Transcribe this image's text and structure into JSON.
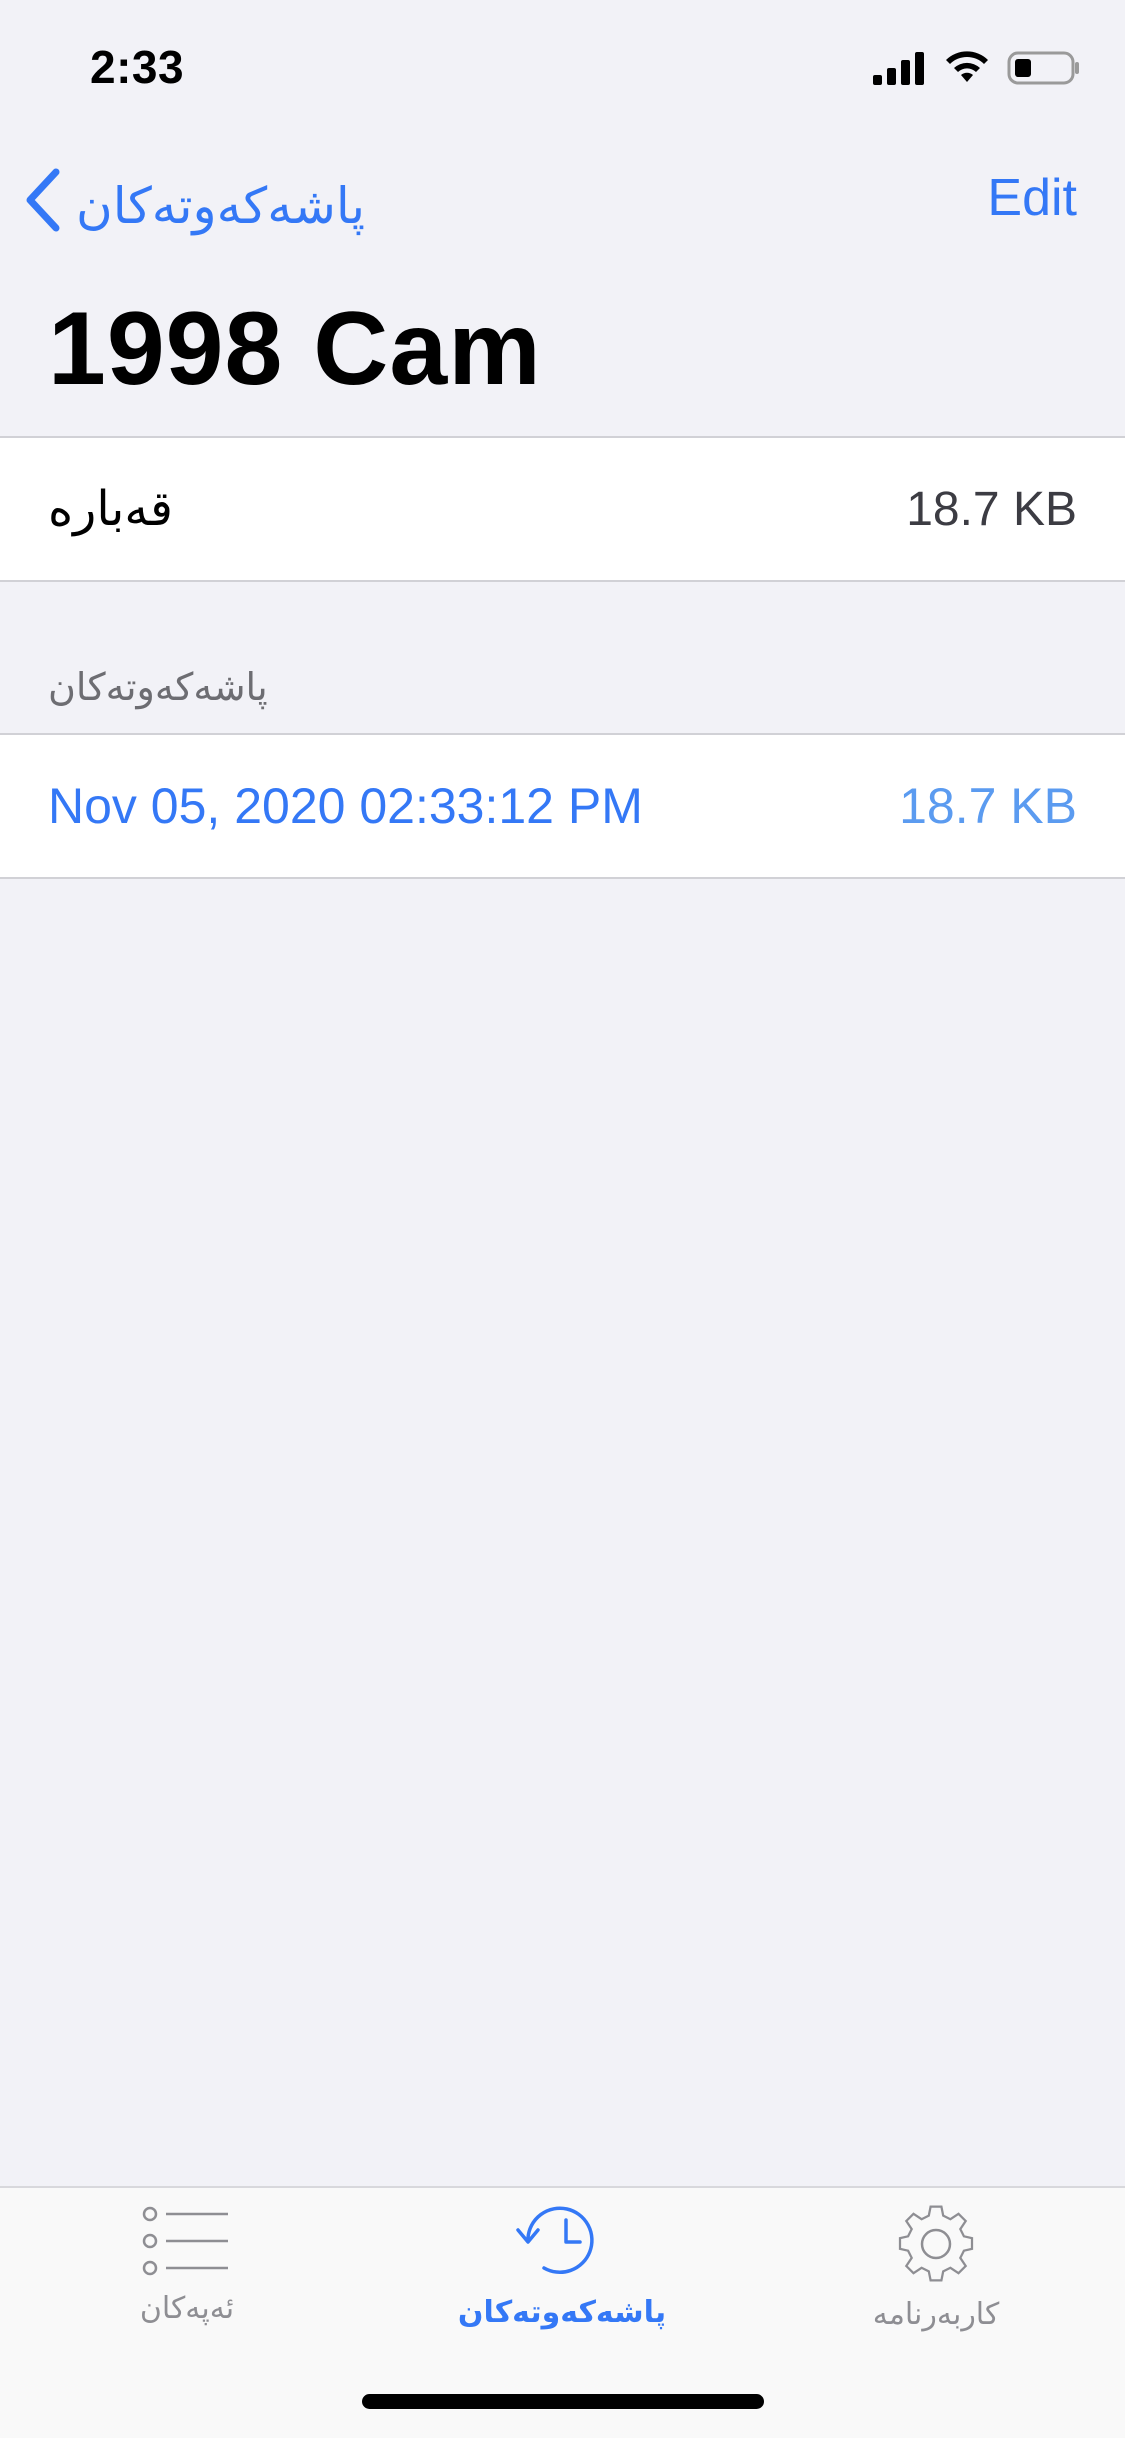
{
  "status_bar": {
    "time": "2:33"
  },
  "nav": {
    "back_label": "پاشەکەوتەکان",
    "edit_label": "Edit"
  },
  "title": "1998 Cam",
  "info": {
    "size_label": "قەبارە",
    "size_value": "18.7 KB"
  },
  "history": {
    "header": "پاشەکەوتەکان",
    "items": [
      {
        "date": "Nov 05, 2020 02:33:12 PM",
        "size": "18.7 KB"
      }
    ]
  },
  "tab_bar": {
    "tabs": [
      {
        "label": "ئەپەکان",
        "icon": "list-icon",
        "active": false
      },
      {
        "label": "پاشەکەوتەکان",
        "icon": "history-icon",
        "active": true
      },
      {
        "label": "کاربەرنامە",
        "icon": "gear-icon",
        "active": false
      }
    ]
  },
  "colors": {
    "accent": "#3478f6",
    "background": "#f2f2f7",
    "secondary_text": "#8e8e93"
  }
}
